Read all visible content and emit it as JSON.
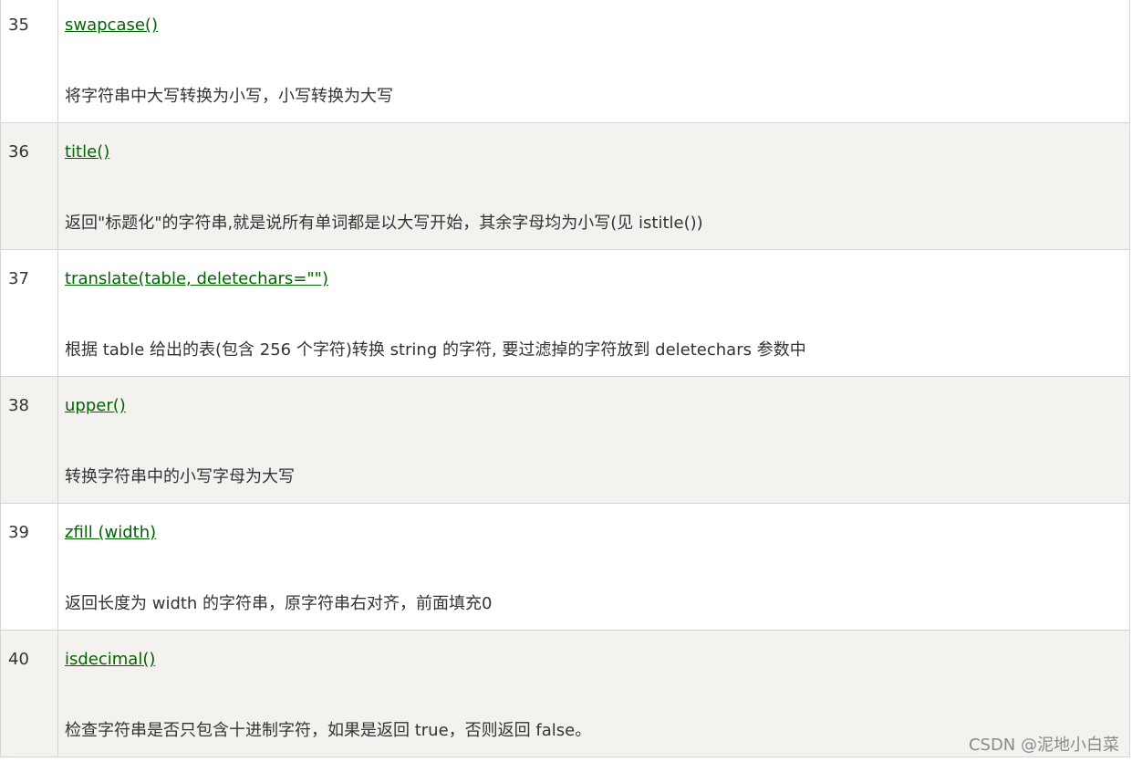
{
  "rows": [
    {
      "num": "35",
      "method": "swapcase()",
      "desc": "将字符串中大写转换为小写，小写转换为大写"
    },
    {
      "num": "36",
      "method": "title()",
      "desc": "返回\"标题化\"的字符串,就是说所有单词都是以大写开始，其余字母均为小写(见 istitle())"
    },
    {
      "num": "37",
      "method": "translate(table, deletechars=\"\")",
      "desc": "根据 table 给出的表(包含 256 个字符)转换 string 的字符, 要过滤掉的字符放到 deletechars 参数中"
    },
    {
      "num": "38",
      "method": "upper()",
      "desc": "转换字符串中的小写字母为大写"
    },
    {
      "num": "39",
      "method": "zfill (width)",
      "desc": "返回长度为 width 的字符串，原字符串右对齐，前面填充0"
    },
    {
      "num": "40",
      "method": "isdecimal()",
      "desc": "检查字符串是否只包含十进制字符，如果是返回 true，否则返回 false。"
    }
  ],
  "watermark": "CSDN @泥地小白菜",
  "colors": {
    "link": "#006600",
    "alt_row_bg": "#f3f2ee",
    "border": "#d4d4d4",
    "text": "#333333"
  }
}
